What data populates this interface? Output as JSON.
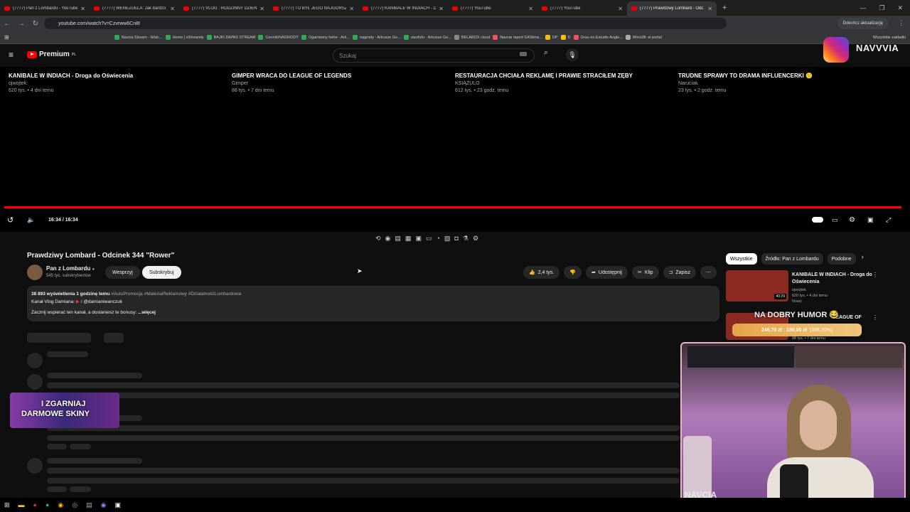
{
  "browser": {
    "tabs": [
      {
        "title": "(7777) Pan z Lombardu - YouTube"
      },
      {
        "title": "(7777) WENEZUELA: Jak bardzo je"
      },
      {
        "title": "(7777) VLOG : RODZINNY DZIEŃ"
      },
      {
        "title": "(7777) TO BYŁ JEGO NAJGORSZY"
      },
      {
        "title": "(7777) KANIBALE W INDIACH - D"
      },
      {
        "title": "(7777) YouTube"
      },
      {
        "title": "(7777) YouTube"
      },
      {
        "title": "(7777) Prawdziwy Lombard - Odc"
      }
    ],
    "url": "youtube.com/watch?v=Czvrww6Cn8I",
    "update_label": "Dokończ aktualizację",
    "bookmarks": [
      "Navcia Stream - Watc...",
      "Home | eStreamly",
      "BAJKI ZAPAS STREAM",
      "Cennik/NAGRODY",
      "Ogarniemy hehe - Ark...",
      "nagrody - Arkusze Go...",
      "uwufufu - Arkusze Go...",
      "BELABOX cloud",
      "Navcia raport G4Skins...",
      "DP",
      "D",
      "Grau en Estudis Angle...",
      "MónUB: el portal",
      "Wszystkie zakładki"
    ]
  },
  "yt": {
    "logo": "Premium",
    "logo_sup": "PL",
    "search_placeholder": "Szukaj",
    "endcards": [
      {
        "title": "KANIBALE W INDIACH - Droga do Oświecenia",
        "channel": "ojwojtek",
        "meta": "620 tys. • 4 dni temu"
      },
      {
        "title": "GIMPER WRACA DO LEAGUE OF LEGENDS",
        "channel": "Gimper",
        "meta": "88 tys. • 7 dni temu"
      },
      {
        "title": "RESTAURACJA CHCIAŁA REKLAMĘ I PRAWIE STRACIŁEM ZĘBY",
        "channel": "KSIĄŻULO",
        "meta": "612 tys. • 23 godz. temu"
      },
      {
        "title": "TRUDNE SPRAWY TO DRAMA INFLUENCERKI 🙂",
        "channel": "Naruciak",
        "meta": "23 tys. • 2 godz. temu"
      }
    ],
    "time": "16:34 / 16:34",
    "video_title": "Prawdziwy Lombard - Odcinek 344 \"Rower\"",
    "channel": "Pan z Lombardu",
    "subscribers": "545 tys. subskrybentów",
    "support_label": "Wesprzyj",
    "subscribe_label": "Subskrybuj",
    "likes": "2,4 tys.",
    "share_label": "Udostępnij",
    "clip_label": "Klip",
    "save_label": "Zapisz",
    "desc_stats": "38 893 wyświetlenia  1 godzinę temu",
    "desc_tags": "#AutoPromocja #MaterialReklamowy #DziałalnośćLombardowa",
    "desc_line2": "Kanał Vlog Damiana:",
    "desc_line2b": "/ @damianiwanczuk",
    "desc_line3": "Zacznij wspierać ten kanał, a dostaniesz te bonusy:",
    "desc_more": "...więcej",
    "chips": [
      "Wszystkie",
      "Źródło: Pan z Lombardu",
      "Podobne"
    ],
    "rec": [
      {
        "title": "KANIBALE W INDIACH - Droga do Oświecenia",
        "channel": "ojwojtek",
        "meta": "620 tys. • 4 dni temu",
        "badge": "Nowy",
        "duration": "40:29"
      },
      {
        "title": "LEAGUE OF",
        "meta": "88 tys. • 7 dni temu"
      }
    ]
  },
  "overlay": {
    "ig_name": "NAVVVIA",
    "humor": "NA DOBRY HUMOR 😂",
    "price": "246,70 zł : 100,00 zł",
    "price_pct": "(246,70%)",
    "promo_line1": "I ZGARNIAJ",
    "promo_line2": "DARMOWE SKINY",
    "cam_watermark": "NAVCIA"
  }
}
